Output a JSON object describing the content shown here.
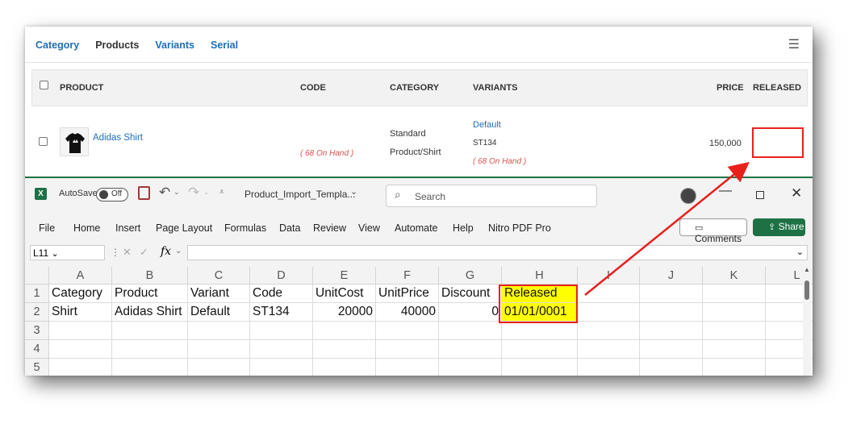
{
  "web": {
    "tabs": [
      "Category",
      "Products",
      "Variants",
      "Serial"
    ],
    "active_tab": "Products",
    "columns": {
      "product": "PRODUCT",
      "code": "CODE",
      "category": "CATEGORY",
      "variants": "VARIANTS",
      "price": "PRICE",
      "released": "RELEASED"
    },
    "row": {
      "product_name": "Adidas Shirt",
      "code_onhand": "( 68 On Hand )",
      "category_line1": "Standard",
      "category_line2": "Product/Shirt",
      "variant_name": "Default",
      "variant_code": "ST134",
      "variant_onhand": "( 68 On Hand )",
      "price": "150,000",
      "released": ""
    }
  },
  "excel": {
    "autosave_label": "AutoSave",
    "autosave_state": "Off",
    "filename": "Product_Import_Templa...",
    "search_placeholder": "Search",
    "menu": [
      "File",
      "Home",
      "Insert",
      "Page Layout",
      "Formulas",
      "Data",
      "Review",
      "View",
      "Automate",
      "Help",
      "Nitro PDF Pro"
    ],
    "comments_label": "Comments",
    "share_label": "Share",
    "name_box": "L11",
    "fx_label": "fx",
    "columns": [
      "A",
      "B",
      "C",
      "D",
      "E",
      "F",
      "G",
      "H",
      "I",
      "J",
      "K",
      "L"
    ],
    "row_numbers": [
      "1",
      "2",
      "3",
      "4",
      "5"
    ],
    "header_row": [
      "Category",
      "Product",
      "Variant",
      "Code",
      "UnitCost",
      "UnitPrice",
      "Discount",
      "Released"
    ],
    "data_row": [
      "Shirt",
      "Adidas Shirt",
      "Default",
      "ST134",
      "20000",
      "40000",
      "0",
      "01/01/0001"
    ]
  },
  "colors": {
    "link": "#1f6db5",
    "excel_green": "#1e7145",
    "highlight": "#ffff00",
    "annotation_red": "#e8201c"
  }
}
